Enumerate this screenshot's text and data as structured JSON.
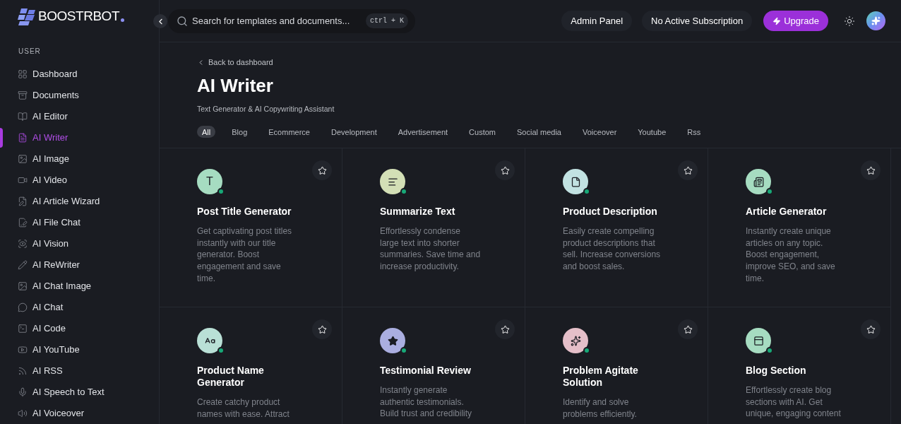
{
  "logo": {
    "text": "BOOSTRBOT"
  },
  "sidebar": {
    "section": "USER",
    "items": [
      {
        "label": "Dashboard",
        "selected": false
      },
      {
        "label": "Documents",
        "selected": false
      },
      {
        "label": "AI Editor",
        "selected": false
      },
      {
        "label": "AI Writer",
        "selected": true
      },
      {
        "label": "AI Image",
        "selected": false
      },
      {
        "label": "AI Video",
        "selected": false
      },
      {
        "label": "AI Article Wizard",
        "selected": false
      },
      {
        "label": "AI File Chat",
        "selected": false
      },
      {
        "label": "AI Vision",
        "selected": false
      },
      {
        "label": "AI ReWriter",
        "selected": false
      },
      {
        "label": "AI Chat Image",
        "selected": false
      },
      {
        "label": "AI Chat",
        "selected": false
      },
      {
        "label": "AI Code",
        "selected": false
      },
      {
        "label": "AI YouTube",
        "selected": false
      },
      {
        "label": "AI RSS",
        "selected": false
      },
      {
        "label": "AI Speech to Text",
        "selected": false
      },
      {
        "label": "AI Voiceover",
        "selected": false
      }
    ]
  },
  "header": {
    "search": {
      "placeholder": "Search for templates and documents...",
      "shortcut": "ctrl + K"
    },
    "buttons": [
      "Admin Panel",
      "No Active Subscription"
    ],
    "upgrade": "Upgrade"
  },
  "page": {
    "back": "Back to dashboard",
    "title": "AI Writer",
    "subtitle": "Text Generator & AI Copywriting Assistant",
    "filters": [
      {
        "label": "All",
        "selected": true
      },
      {
        "label": "Blog",
        "selected": false
      },
      {
        "label": "Ecommerce",
        "selected": false
      },
      {
        "label": "Development",
        "selected": false
      },
      {
        "label": "Advertisement",
        "selected": false
      },
      {
        "label": "Custom",
        "selected": false
      },
      {
        "label": "Social media",
        "selected": false
      },
      {
        "label": "Voiceover",
        "selected": false
      },
      {
        "label": "Youtube",
        "selected": false
      },
      {
        "label": "Rss",
        "selected": false
      }
    ]
  },
  "templates": [
    {
      "title": "Post Title Generator",
      "icon_text": "T",
      "color": "#a6dcc1",
      "description": [
        "Get captivating post titles",
        "instantly with our title",
        "generator. Boost",
        "engagement and save",
        "time."
      ]
    },
    {
      "title": "Summarize Text",
      "color": "#d3dfb6",
      "description": [
        "Effortlessly condense",
        "large text into shorter",
        "summaries. Save time and",
        "increase productivity."
      ]
    },
    {
      "title": "Product Description",
      "color": "#c2e2e2",
      "description": [
        "Easily create compelling",
        "product descriptions that",
        "sell. Increase conversions",
        "and boost sales."
      ]
    },
    {
      "title": "Article Generator",
      "color": "#a6dcc1",
      "description": [
        "Instantly create unique",
        "articles on any topic.",
        "Boost engagement,",
        "improve SEO, and save",
        "time."
      ]
    },
    {
      "title": "Product Name Generator",
      "color": "#b9e0d6",
      "description": [
        "Create catchy product",
        "names with ease. Attract"
      ]
    },
    {
      "title": "Testimonial Review",
      "color": "#aaaee0",
      "description": [
        "Instantly generate",
        "authentic testimonials.",
        "Build trust and credibility"
      ]
    },
    {
      "title": "Problem Agitate Solution",
      "color": "#e5bfc9",
      "description": [
        "Identify and solve",
        "problems efficiently."
      ]
    },
    {
      "title": "Blog Section",
      "color": "#a6dcc1",
      "description": [
        "Effortlessly create blog",
        "sections with AI. Get",
        "unique, engaging content"
      ]
    }
  ]
}
